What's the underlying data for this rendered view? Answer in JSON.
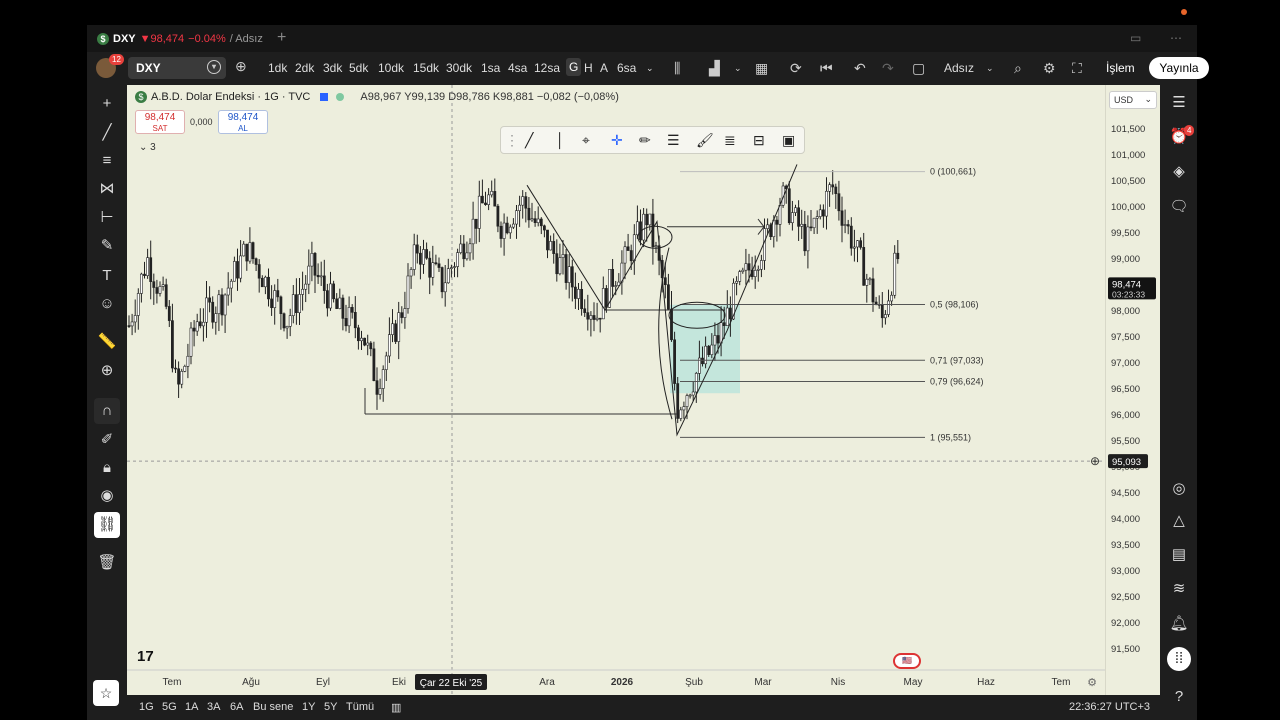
{
  "tab": {
    "symbol": "DXY",
    "price": "▼98,474",
    "change": "−0.04%",
    "layout_name": "/ Adsız"
  },
  "toolbar": {
    "notif_count": "12",
    "symbol": "DXY",
    "timeframes": [
      "1dk",
      "2dk",
      "3dk",
      "5dk",
      "10dk",
      "15dk",
      "30dk",
      "1sa",
      "4sa",
      "12sa",
      "G",
      "H",
      "A",
      "6sa"
    ],
    "active_timeframe": "G",
    "layout_label": "Adsız",
    "islem": "İşlem",
    "yayinla": "Yayınla"
  },
  "legend": {
    "title": "A.B.D. Dolar Endeksi · 1G · TVC",
    "ohlc": "A98,967  Y99,139  D98,786  K98,881  −0,082 (−0,08%)",
    "sell_price": "98,474",
    "sell_label": "SAT",
    "spread": "0,000",
    "buy_price": "98,474",
    "buy_label": "AL",
    "collapsed_count": "3"
  },
  "price_axis": {
    "currency": "USD",
    "labels": [
      "101,500",
      "101,000",
      "100,500",
      "100,000",
      "99,500",
      "99,000",
      "98,500",
      "98,000",
      "97,500",
      "97,000",
      "96,500",
      "96,000",
      "95,500",
      "95,000",
      "94,500",
      "94,000",
      "93,500",
      "93,000",
      "92,500",
      "92,000",
      "91,500"
    ],
    "current_price": "98,474",
    "countdown": "03:23:33",
    "crosshair_price": "95,093"
  },
  "time_axis": {
    "labels": [
      "Tem",
      "Ağu",
      "Eyl",
      "Eki",
      "Ara",
      "2026",
      "Şub",
      "Mar",
      "Nis",
      "May",
      "Haz",
      "Tem"
    ],
    "crosshair_date": "Çar 22 Eki '25"
  },
  "fib_levels": [
    {
      "label": "0 (100,661)",
      "price": 100.661
    },
    {
      "label": "0,5 (98,106)",
      "price": 98.106
    },
    {
      "label": "0,71 (97,033)",
      "price": 97.033
    },
    {
      "label": "0,79 (96,624)",
      "price": 96.624
    },
    {
      "label": "1 (95,551)",
      "price": 95.551
    }
  ],
  "right_badge": "4",
  "bottom": {
    "ranges": [
      "1G",
      "5G",
      "1A",
      "3A",
      "6A",
      "Bu sene",
      "1Y",
      "5Y",
      "Tümü"
    ],
    "clock": "22:36:27 UTC+3"
  },
  "chart_data": {
    "type": "candlestick",
    "symbol": "DXY",
    "y_range": [
      91.3,
      101.9
    ],
    "approx_close_path": [
      {
        "x": "Tem",
        "y": 97.6
      },
      {
        "x": "Ağu",
        "y": 98.7
      },
      {
        "x": "Eyl",
        "y": 97.4
      },
      {
        "x": "Eki",
        "y": 98.4
      },
      {
        "x": "Ara",
        "y": 98.8
      },
      {
        "x": "2026",
        "y": 98.6
      },
      {
        "x": "Şub",
        "y": 96.2
      },
      {
        "x": "Mar",
        "y": 98.0
      },
      {
        "x": "Nis",
        "y": 99.8
      },
      {
        "x": "May",
        "y": 98.5
      }
    ],
    "last_price": 98.474
  },
  "colors": {
    "chart_bg": "#edeedd",
    "down": "#f23645",
    "buy": "#1e55c8",
    "highlight": "#b9e4dc"
  }
}
